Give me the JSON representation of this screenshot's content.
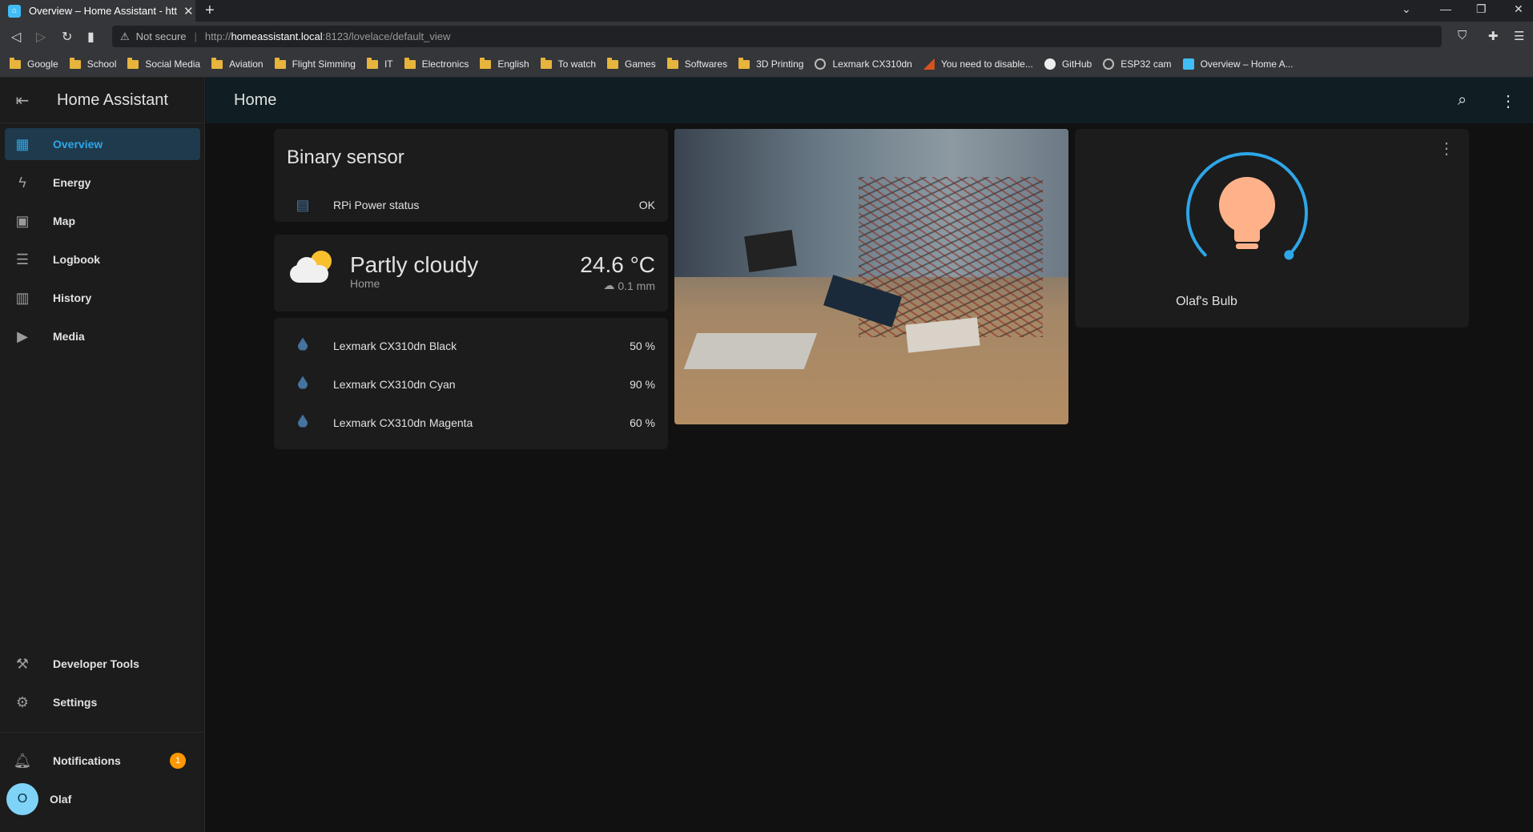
{
  "browser": {
    "tab_title": "Overview – Home Assistant - http",
    "tab_close": "✕",
    "new_tab": "+",
    "url_warning_icon": "⚠",
    "url_not_secure": "Not secure",
    "url_proto": "http://",
    "url_host": "homeassistant.local",
    "url_path": ":8123/lovelace/default_view",
    "bookmarks": [
      {
        "label": "Google",
        "icon": "folder"
      },
      {
        "label": "School",
        "icon": "folder"
      },
      {
        "label": "Social Media",
        "icon": "folder"
      },
      {
        "label": "Aviation",
        "icon": "folder"
      },
      {
        "label": "Flight Simming",
        "icon": "folder"
      },
      {
        "label": "IT",
        "icon": "folder"
      },
      {
        "label": "Electronics",
        "icon": "folder"
      },
      {
        "label": "English",
        "icon": "folder"
      },
      {
        "label": "To watch",
        "icon": "folder"
      },
      {
        "label": "Games",
        "icon": "folder"
      },
      {
        "label": "Softwares",
        "icon": "folder"
      },
      {
        "label": "3D Printing",
        "icon": "folder"
      },
      {
        "label": "Lexmark CX310dn",
        "icon": "globe"
      },
      {
        "label": "You need to disable...",
        "icon": "arrow"
      },
      {
        "label": "GitHub",
        "icon": "github"
      },
      {
        "label": "ESP32 cam",
        "icon": "globe"
      },
      {
        "label": "Overview – Home A...",
        "icon": "home-assistant"
      }
    ]
  },
  "sidebar": {
    "title": "Home Assistant",
    "items": [
      {
        "label": "Overview",
        "icon": "dashboard-icon",
        "active": true
      },
      {
        "label": "Energy",
        "icon": "lightning-icon"
      },
      {
        "label": "Map",
        "icon": "map-icon"
      },
      {
        "label": "Logbook",
        "icon": "list-icon"
      },
      {
        "label": "History",
        "icon": "chart-icon"
      },
      {
        "label": "Media",
        "icon": "media-icon"
      }
    ],
    "bottom": [
      {
        "label": "Developer Tools",
        "icon": "hammer-icon"
      },
      {
        "label": "Settings",
        "icon": "gear-icon"
      }
    ],
    "notifications": {
      "label": "Notifications",
      "count": "1"
    },
    "user": {
      "name": "Olaf",
      "initial": "O"
    }
  },
  "header": {
    "title": "Home"
  },
  "binary_sensor_card": {
    "title": "Binary sensor",
    "rows": [
      {
        "label": "RPi Power status",
        "value": "OK"
      }
    ]
  },
  "weather_card": {
    "condition": "Partly cloudy",
    "location": "Home",
    "temperature": "24.6 °C",
    "precipitation": "0.1 mm"
  },
  "printer_card": {
    "rows": [
      {
        "label": "Lexmark CX310dn Black",
        "value": "50 %"
      },
      {
        "label": "Lexmark CX310dn Cyan",
        "value": "90 %"
      },
      {
        "label": "Lexmark CX310dn Magenta",
        "value": "60 %"
      }
    ]
  },
  "light_card": {
    "name": "Olaf's Bulb",
    "brightness": 1.0,
    "bulb_color": "#ffb28a",
    "ring_color": "#2ea6e8"
  },
  "colors": {
    "accent": "#2ea6e8",
    "badge": "#ff9800"
  }
}
